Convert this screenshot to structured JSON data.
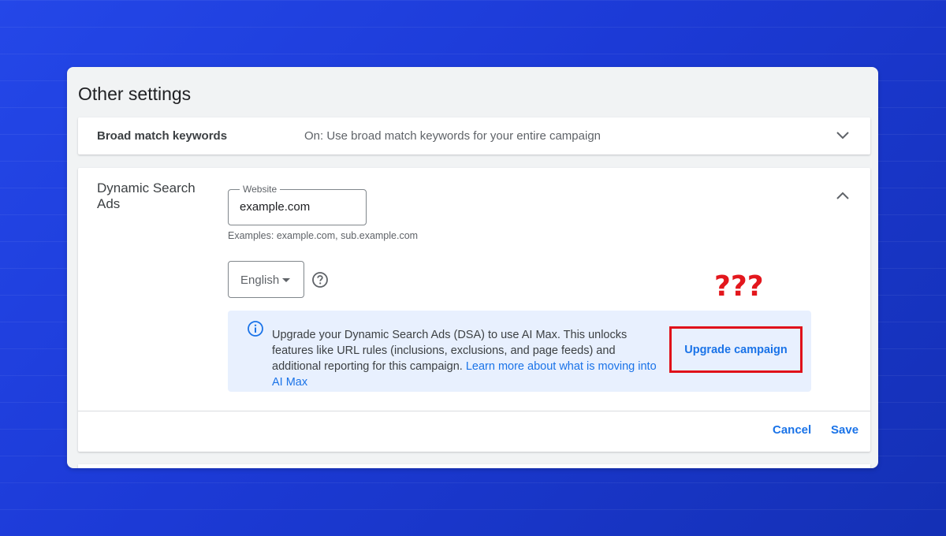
{
  "section_title": "Other settings",
  "broad_match": {
    "label": "Broad match keywords",
    "summary": "On: Use broad match keywords for your entire campaign"
  },
  "dsa": {
    "label": "Dynamic Search Ads",
    "website_legend": "Website",
    "website_value": "example.com",
    "hint": "Examples: example.com, sub.example.com",
    "language": "English",
    "info_text": "Upgrade your Dynamic Search Ads (DSA) to use AI Max. This unlocks features like URL rules (inclusions, exclusions, and page feeds) and additional reporting for this campaign.",
    "info_link": "Learn more about what is moving into AI Max",
    "upgrade_button": "Upgrade campaign",
    "annotation": "???"
  },
  "footer": {
    "cancel": "Cancel",
    "save": "Save"
  },
  "colors": {
    "accent": "#1a73e8",
    "highlight": "#e0111a",
    "info_bg": "#e8f0fe"
  }
}
